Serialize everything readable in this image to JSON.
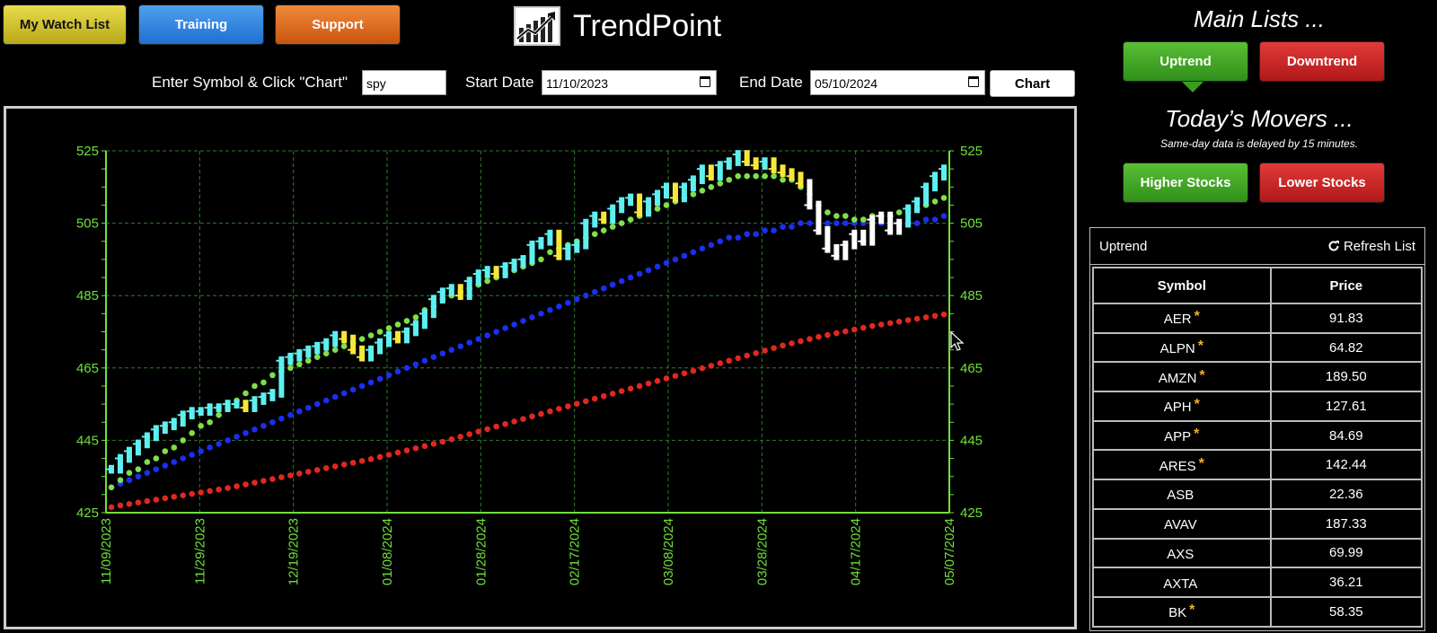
{
  "nav": {
    "watch_list": "My Watch List",
    "training": "Training",
    "support": "Support"
  },
  "brand": {
    "name": "TrendPoint",
    "icon": "trend-chart-logo-icon"
  },
  "form": {
    "symbol_label": "Enter Symbol & Click \"Chart\"",
    "symbol_value": "spy",
    "start_label": "Start Date",
    "start_value": "11/10/2023",
    "end_label": "End Date",
    "end_value": "05/10/2024",
    "chart_button": "Chart"
  },
  "right": {
    "main_lists_title": "Main Lists ...",
    "uptrend": "Uptrend",
    "downtrend": "Downtrend",
    "movers_title": "Today’s Movers ...",
    "movers_note": "Same-day data is delayed by 15 minutes.",
    "higher": "Higher Stocks",
    "lower": "Lower Stocks",
    "list_name": "Uptrend",
    "refresh": "Refresh List",
    "columns": [
      "Symbol",
      "Price"
    ],
    "rows": [
      {
        "symbol": "AER",
        "price": "91.83",
        "star": "*"
      },
      {
        "symbol": "ALPN",
        "price": "64.82",
        "star": "*"
      },
      {
        "symbol": "AMZN",
        "price": "189.50",
        "star": "*"
      },
      {
        "symbol": "APH",
        "price": "127.61",
        "star": "*"
      },
      {
        "symbol": "APP",
        "price": "84.69",
        "star": "*"
      },
      {
        "symbol": "ARES",
        "price": "142.44",
        "star": "*"
      },
      {
        "symbol": "ASB",
        "price": "22.36",
        "star": ""
      },
      {
        "symbol": "AVAV",
        "price": "187.33",
        "star": ""
      },
      {
        "symbol": "AXS",
        "price": "69.99",
        "star": ""
      },
      {
        "symbol": "AXTA",
        "price": "36.21",
        "star": ""
      },
      {
        "symbol": "BK",
        "price": "58.35",
        "star": "*"
      }
    ]
  },
  "colors": {
    "grid": "#2f7a2f",
    "axis": "#6fe03a",
    "ma_fast": "#7ee04a",
    "ma_mid": "#1a2ff0",
    "ma_slow": "#e0281e",
    "up_bar": "#5ef0f0",
    "hl_bar": "#f5e83a",
    "down_bar": "#ffffff"
  },
  "chart_data": {
    "type": "line",
    "yticks": [
      "425",
      "445",
      "465",
      "485",
      "505",
      "525"
    ],
    "ylim": [
      425,
      525
    ],
    "xticks": [
      "11/09/2023",
      "11/29/2023",
      "12/19/2023",
      "01/08/2024",
      "01/28/2024",
      "02/17/2024",
      "03/08/2024",
      "03/28/2024",
      "04/17/2024",
      "05/07/2024"
    ],
    "x_start": "11/09/2023",
    "x_end": "05/07/2024",
    "series": [
      {
        "key": "price",
        "values": [
          437,
          440,
          442,
          444,
          446,
          448,
          449,
          450,
          452,
          453,
          453,
          454,
          454,
          455,
          455,
          454,
          456,
          457,
          458,
          467,
          468,
          469,
          470,
          471,
          472,
          474,
          473,
          470,
          468,
          470,
          472,
          474,
          473,
          475,
          477,
          480,
          484,
          486,
          487,
          485,
          489,
          491,
          492,
          491,
          493,
          494,
          495,
          499,
          500,
          502,
          496,
          498,
          499,
          505,
          507,
          506,
          509,
          511,
          512,
          508,
          511,
          513,
          515,
          512,
          515,
          517,
          520,
          518,
          521,
          522,
          524,
          522,
          521,
          522,
          520,
          519,
          518,
          516,
          510,
          503,
          498,
          496,
          499,
          502,
          500,
          506,
          507,
          503,
          505,
          509,
          511,
          515,
          518,
          520
        ]
      },
      {
        "key": "ma_fast",
        "values": [
          432,
          434,
          436,
          437,
          439,
          440,
          442,
          443,
          445,
          447,
          449,
          450,
          452,
          454,
          456,
          458,
          460,
          461,
          463,
          464,
          465,
          466,
          467,
          468,
          469,
          470,
          471,
          472,
          473,
          474,
          475,
          476,
          477,
          478,
          479,
          481,
          482,
          484,
          485,
          486,
          487,
          488,
          489,
          490,
          491,
          492,
          493,
          494,
          495,
          497,
          498,
          499,
          500,
          501,
          502,
          503,
          504,
          505,
          506,
          507,
          508,
          509,
          510,
          511,
          512,
          513,
          514,
          515,
          516,
          517,
          518,
          518,
          518,
          518,
          518,
          517,
          517,
          515,
          513,
          510,
          508,
          507,
          507,
          506,
          506,
          507,
          507,
          507,
          508,
          508,
          509,
          510,
          511,
          512
        ]
      },
      {
        "key": "ma_mid",
        "values": [
          432,
          433,
          434,
          435,
          436,
          437,
          438,
          439,
          440,
          441,
          442,
          443,
          444,
          445,
          446,
          447,
          448,
          449,
          450,
          451,
          452,
          453,
          454,
          455,
          456,
          457,
          458,
          459,
          460,
          461,
          462,
          463,
          464,
          465,
          466,
          467,
          468,
          469,
          470,
          471,
          472,
          473,
          474,
          475,
          476,
          477,
          478,
          479,
          480,
          481,
          482,
          483,
          484,
          485,
          486,
          487,
          488,
          489,
          490,
          491,
          492,
          493,
          494,
          495,
          496,
          497,
          498,
          499,
          500,
          501,
          501,
          502,
          502,
          503,
          503,
          504,
          504,
          505,
          505,
          505,
          505,
          505,
          505,
          505,
          505,
          505,
          505,
          505,
          505,
          505,
          505,
          506,
          506,
          507
        ]
      },
      {
        "key": "ma_slow",
        "values": [
          426.5,
          427,
          427.4,
          427.8,
          428.2,
          428.6,
          429,
          429.4,
          429.8,
          430.2,
          430.6,
          431,
          431.4,
          431.8,
          432.3,
          432.8,
          433.3,
          433.8,
          434.3,
          434.8,
          435.3,
          435.8,
          436.3,
          436.8,
          437.3,
          437.8,
          438.3,
          438.8,
          439.3,
          439.8,
          440.4,
          441,
          441.6,
          442.2,
          442.8,
          443.4,
          444,
          444.6,
          445.3,
          446,
          446.7,
          447.4,
          448.1,
          448.8,
          449.5,
          450.2,
          450.9,
          451.6,
          452.3,
          453,
          453.7,
          454.4,
          455.1,
          455.8,
          456.5,
          457.2,
          457.9,
          458.6,
          459.3,
          460,
          460.7,
          461.4,
          462.1,
          462.8,
          463.5,
          464.2,
          464.9,
          465.6,
          466.3,
          467,
          467.7,
          468.4,
          469.1,
          469.8,
          470.5,
          471.2,
          471.8,
          472.4,
          473,
          473.6,
          474.1,
          474.6,
          475.1,
          475.6,
          476.1,
          476.6,
          477,
          477.4,
          477.8,
          478.2,
          478.6,
          479,
          479.4,
          479.8
        ]
      }
    ]
  }
}
